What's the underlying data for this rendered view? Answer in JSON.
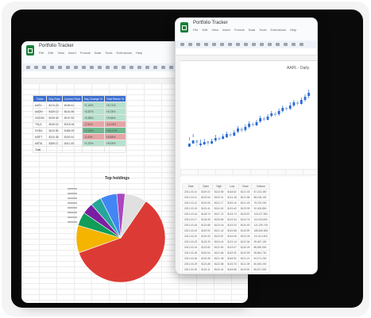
{
  "left_window": {
    "title": "Portfolio Tracker",
    "menu": [
      "File",
      "Edit",
      "View",
      "Insert",
      "Format",
      "Data",
      "Tools",
      "Extensions",
      "Help"
    ],
    "holdings_table": {
      "headers": [
        "Ticker",
        "Buy Price",
        "Current Price",
        "Day Change %",
        "Total Return %"
      ],
      "rows": [
        [
          "AAPL",
          "$174.23",
          "$189.41",
          "+1.24%",
          "+8.71%"
        ],
        [
          "AMZN",
          "$130.12",
          "$141.55",
          "+0.87%",
          "+8.78%"
        ],
        [
          "GOOGL",
          "$125.40",
          "$137.92",
          "+0.55%",
          "+9.98%"
        ],
        [
          "TSLA",
          "$245.10",
          "$218.06",
          "-2.31%",
          "-11.03%"
        ],
        [
          "NVDA",
          "$410.50",
          "$485.09",
          "+2.14%",
          "+18.17%"
        ],
        [
          "MSFT",
          "$310.48",
          "$330.91",
          "-0.42%",
          "+6.58%"
        ],
        [
          "META",
          "$289.17",
          "$312.40",
          "+1.02%",
          "+8.03%"
        ],
        [
          "Total",
          "",
          "",
          "",
          ""
        ]
      ],
      "highlight": [
        "pos",
        "pos",
        "pos",
        "neg",
        "pos2",
        "neg",
        "pos",
        "none"
      ]
    },
    "pie_chart": {
      "title": "Top holdings",
      "slice_colors": [
        "#dc3b35",
        "#f4b400",
        "#0f9d58",
        "#7b1fa2",
        "#26a69a",
        "#4285f4",
        "#ab47bc",
        "#e0e0e0"
      ],
      "slice_values": [
        60,
        10,
        5,
        4,
        4,
        6,
        3,
        8
      ]
    }
  },
  "right_window": {
    "title": "Portfolio Tracker",
    "menu": [
      "File",
      "Edit",
      "View",
      "Insert",
      "Format",
      "Data",
      "Tools",
      "Extensions",
      "Help"
    ],
    "chart_title": "AAPL - Daily",
    "history_table": {
      "headers": [
        "Date",
        "Open",
        "High",
        "Low",
        "Close",
        "Volume"
      ],
      "rows": [
        [
          "2021-03-10",
          "$119.02",
          "$123.55",
          "$118.62",
          "$121.03",
          "87,213,400"
        ],
        [
          "2021-03-11",
          "$122.54",
          "$123.21",
          "$121.26",
          "$121.96",
          "88,105,100"
        ],
        [
          "2021-03-12",
          "$120.40",
          "$121.17",
          "$119.16",
          "$121.03",
          "79,075,200"
        ],
        [
          "2021-03-15",
          "$121.41",
          "$124.00",
          "$120.42",
          "$123.99",
          "92,403,800"
        ],
        [
          "2021-03-16",
          "$125.70",
          "$127.22",
          "$124.72",
          "$125.57",
          "115,227,900"
        ],
        [
          "2021-03-17",
          "$124.05",
          "$125.86",
          "$122.34",
          "$124.76",
          "111,932,600"
        ],
        [
          "2021-03-18",
          "$122.88",
          "$123.18",
          "$120.32",
          "$120.53",
          "121,229,700"
        ],
        [
          "2021-03-19",
          "$119.90",
          "$121.43",
          "$119.68",
          "$119.99",
          "185,549,500"
        ],
        [
          "2021-03-22",
          "$120.33",
          "$123.87",
          "$120.26",
          "$123.39",
          "111,912,300"
        ],
        [
          "2021-03-23",
          "$123.33",
          "$124.24",
          "$122.14",
          "$122.54",
          "95,467,100"
        ],
        [
          "2021-03-24",
          "$122.82",
          "$122.90",
          "$120.07",
          "$120.09",
          "88,530,500"
        ],
        [
          "2021-03-25",
          "$119.54",
          "$121.66",
          "$119.00",
          "$120.59",
          "98,844,700"
        ],
        [
          "2021-03-26",
          "$120.35",
          "$121.48",
          "$118.92",
          "$121.21",
          "94,071,200"
        ],
        [
          "2021-03-29",
          "$121.65",
          "$122.58",
          "$120.73",
          "$121.39",
          "80,819,200"
        ],
        [
          "2021-03-30",
          "$120.11",
          "$120.40",
          "$118.86",
          "$119.90",
          "85,671,900"
        ],
        [
          "2021-03-31",
          "$121.65",
          "$123.52",
          "$121.15",
          "$122.15",
          "118,323,800"
        ],
        [
          "2021-04-01",
          "$123.66",
          "$124.18",
          "$122.49",
          "$123.00",
          "75,089,100"
        ],
        [
          "2021-04-05",
          "$123.87",
          "$126.16",
          "$123.07",
          "$125.90",
          "88,651,200"
        ]
      ]
    },
    "candles": [
      [
        0,
        18,
        22,
        26,
        30
      ],
      [
        1,
        22,
        26,
        30,
        34
      ],
      [
        2,
        26,
        23,
        27,
        19
      ],
      [
        3,
        20,
        22,
        27,
        18
      ],
      [
        4,
        21,
        24,
        28,
        20
      ],
      [
        5,
        25,
        22,
        26,
        19
      ],
      [
        6,
        22,
        25,
        28,
        21
      ],
      [
        7,
        26,
        29,
        33,
        24
      ],
      [
        8,
        29,
        27,
        31,
        25
      ],
      [
        9,
        28,
        31,
        34,
        27
      ],
      [
        10,
        30,
        34,
        37,
        29
      ],
      [
        11,
        34,
        32,
        36,
        30
      ],
      [
        12,
        32,
        36,
        39,
        31
      ],
      [
        13,
        37,
        41,
        44,
        35
      ],
      [
        14,
        41,
        38,
        43,
        36
      ],
      [
        15,
        39,
        43,
        46,
        37
      ],
      [
        16,
        43,
        47,
        50,
        41
      ],
      [
        17,
        47,
        45,
        49,
        43
      ],
      [
        18,
        45,
        49,
        52,
        44
      ],
      [
        19,
        50,
        54,
        57,
        48
      ],
      [
        20,
        54,
        52,
        56,
        50
      ],
      [
        21,
        52,
        56,
        59,
        51
      ],
      [
        22,
        57,
        60,
        63,
        55
      ],
      [
        23,
        60,
        58,
        62,
        56
      ],
      [
        24,
        59,
        63,
        66,
        57
      ],
      [
        25,
        63,
        67,
        70,
        61
      ],
      [
        26,
        67,
        65,
        69,
        63
      ],
      [
        27,
        66,
        70,
        74,
        64
      ],
      [
        28,
        70,
        74,
        77,
        68
      ],
      [
        29,
        74,
        72,
        76,
        70
      ],
      [
        30,
        72,
        77,
        80,
        71
      ],
      [
        31,
        77,
        81,
        84,
        75
      ],
      [
        32,
        82,
        86,
        90,
        79
      ]
    ],
    "candle_colors": {
      "up": "#2a6bd6",
      "down": "#9fb7e3"
    }
  }
}
